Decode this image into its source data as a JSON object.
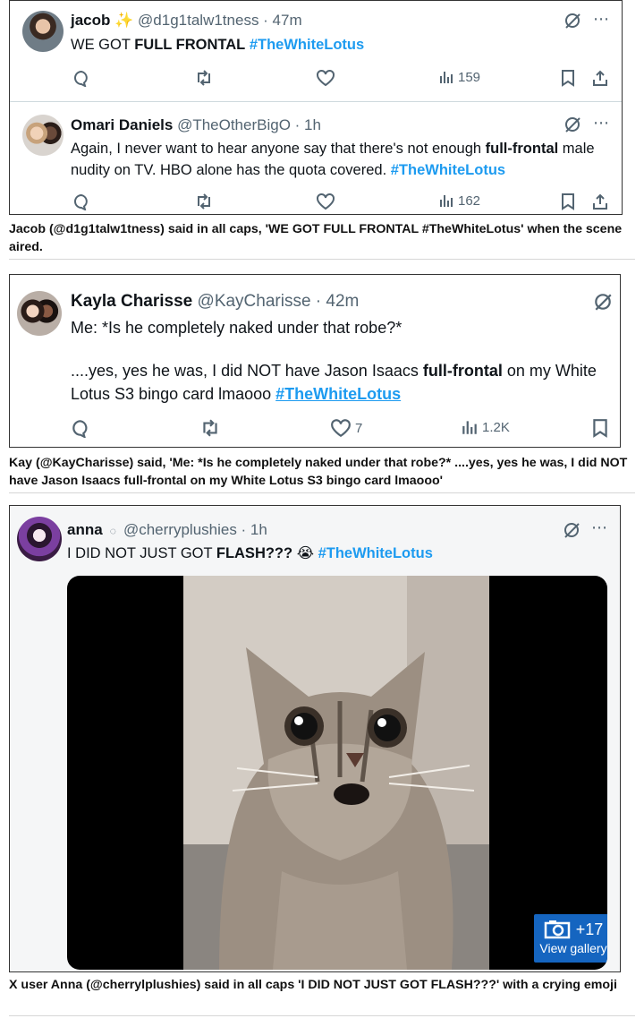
{
  "card1": {
    "tweet1": {
      "name": "jacob",
      "handle_time": "@d1g1talw1tness · 47m",
      "text": {
        "pre": "WE GOT ",
        "bold": "FULL FRONTAL",
        "hashtag": "#TheWhiteLotus"
      },
      "views": "159"
    },
    "tweet2": {
      "name": "Omari Daniels",
      "handle_time": "@TheOtherBigO · 1h",
      "text": {
        "pre": "Again, I never want to hear anyone say that there's not enough ",
        "bold": "full-frontal",
        "post": " male nudity on TV. HBO alone has the quota covered. ",
        "hashtag": "#TheWhiteLotus"
      },
      "views": "162"
    }
  },
  "caption1": "Jacob (@d1g1talw1tness) said in all caps, 'WE GOT FULL FRONTAL #TheWhiteLotus' when the scene aired.",
  "card2": {
    "name": "Kayla Charisse",
    "handle_time": "@KayCharisse · 42m",
    "line1": "Me: *Is he completely naked under that robe?*",
    "line2_pre": "....yes, yes he was, I did NOT have Jason Isaacs ",
    "line2_bold": "full-frontal",
    "line2_post": " on my White Lotus S3 bingo card lmaooo ",
    "hashtag": "#TheWhiteLotus",
    "likes": "7",
    "views": "1.2K"
  },
  "caption2": "Kay (@KayCharisse) said, 'Me: *Is he completely naked under that robe?* ....yes, yes he was, I did NOT have Jason Isaacs full-frontal on my White Lotus S3 bingo card lmaooo'",
  "card3": {
    "name": "anna",
    "handle_time": "@cherryplushies · 1h",
    "text_pre": "I DID NOT JUST GOT ",
    "text_bold": "FLASH???",
    "emoji": "😭",
    "hashtag": "#TheWhiteLotus"
  },
  "gallery": {
    "count": "+17",
    "label": "View gallery"
  },
  "caption3": "X user Anna (@cherrylplushies) said in all caps 'I DID NOT JUST GOT FLASH???' with a crying emoji",
  "icons": [
    "grok-icon",
    "more-icon",
    "reply-icon",
    "retweet-icon",
    "like-icon",
    "views-icon",
    "bookmark-icon",
    "share-icon",
    "camera-icon"
  ],
  "colors": {
    "link": "#1d9bf0",
    "gallery": "#1565c0",
    "muted": "#536471"
  }
}
